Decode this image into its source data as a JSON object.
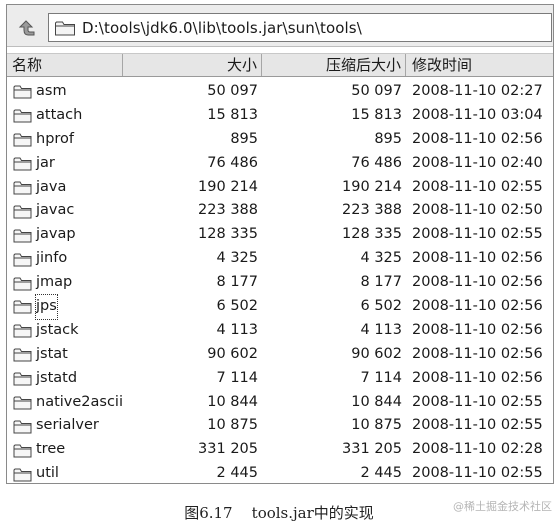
{
  "address_bar": {
    "path": "D:\\tools\\jdk6.0\\lib\\tools.jar\\sun\\tools\\"
  },
  "columns": {
    "name": "名称",
    "size": "大小",
    "compressed": "压缩后大小",
    "modified": "修改时间"
  },
  "files": [
    {
      "name": "asm",
      "size": "50 097",
      "compressed": "50 097",
      "modified": "2008-11-10 02:27"
    },
    {
      "name": "attach",
      "size": "15 813",
      "compressed": "15 813",
      "modified": "2008-11-10 03:04"
    },
    {
      "name": "hprof",
      "size": "895",
      "compressed": "895",
      "modified": "2008-11-10 02:56"
    },
    {
      "name": "jar",
      "size": "76 486",
      "compressed": "76 486",
      "modified": "2008-11-10 02:40"
    },
    {
      "name": "java",
      "size": "190 214",
      "compressed": "190 214",
      "modified": "2008-11-10 02:55"
    },
    {
      "name": "javac",
      "size": "223 388",
      "compressed": "223 388",
      "modified": "2008-11-10 02:50"
    },
    {
      "name": "javap",
      "size": "128 335",
      "compressed": "128 335",
      "modified": "2008-11-10 02:55"
    },
    {
      "name": "jinfo",
      "size": "4 325",
      "compressed": "4 325",
      "modified": "2008-11-10 02:56"
    },
    {
      "name": "jmap",
      "size": "8 177",
      "compressed": "8 177",
      "modified": "2008-11-10 02:56"
    },
    {
      "name": "jps",
      "size": "6 502",
      "compressed": "6 502",
      "modified": "2008-11-10 02:56"
    },
    {
      "name": "jstack",
      "size": "4 113",
      "compressed": "4 113",
      "modified": "2008-11-10 02:56"
    },
    {
      "name": "jstat",
      "size": "90 602",
      "compressed": "90 602",
      "modified": "2008-11-10 02:56"
    },
    {
      "name": "jstatd",
      "size": "7 114",
      "compressed": "7 114",
      "modified": "2008-11-10 02:56"
    },
    {
      "name": "native2ascii",
      "size": "10 844",
      "compressed": "10 844",
      "modified": "2008-11-10 02:55"
    },
    {
      "name": "serialver",
      "size": "10 875",
      "compressed": "10 875",
      "modified": "2008-11-10 02:55"
    },
    {
      "name": "tree",
      "size": "331 205",
      "compressed": "331 205",
      "modified": "2008-11-10 02:28"
    },
    {
      "name": "util",
      "size": "2 445",
      "compressed": "2 445",
      "modified": "2008-11-10 02:55"
    }
  ],
  "focused_item": "jps",
  "caption": "图6.17    tools.jar中的实现",
  "watermark": "@稀土掘金技术社区",
  "icons": {
    "up": "up-folder-icon",
    "address": "folder-icon",
    "item": "folder-icon"
  }
}
